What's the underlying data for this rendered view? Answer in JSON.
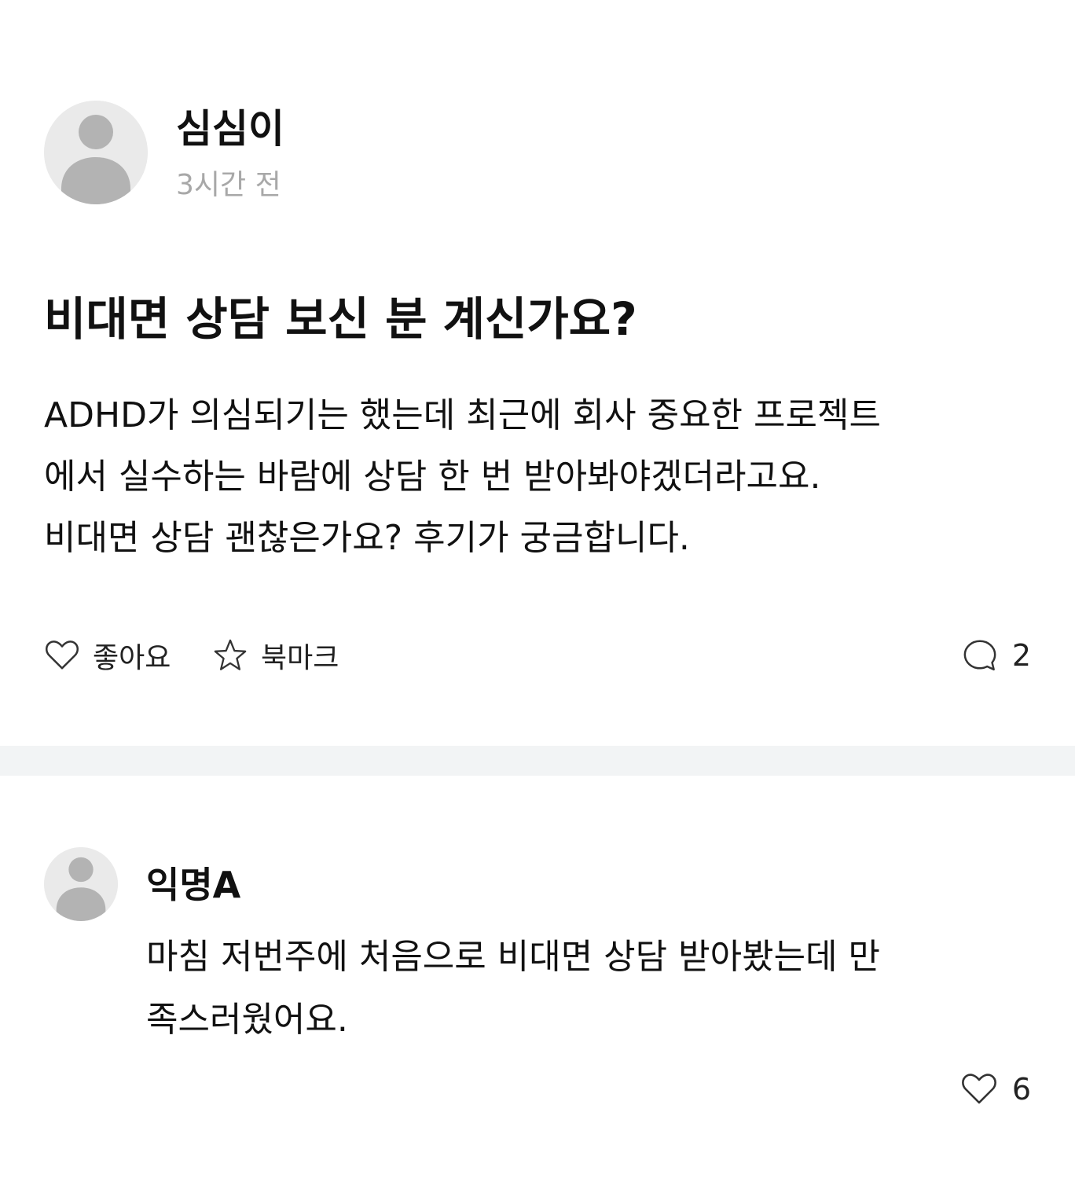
{
  "post": {
    "author": "심심이",
    "time": "3시간 전",
    "title": "비대면 상담 보신 분 계신가요?",
    "body_lines": [
      "ADHD가 의심되기는 했는데 최근에 회사 중요한 프로젝트",
      "에서 실수하는 바람에 상담 한 번 받아봐야겠더라고요.",
      "비대면 상담 괜찮은가요? 후기가 궁금합니다."
    ],
    "actions": {
      "like_label": "좋아요",
      "bookmark_label": "북마크",
      "comment_count": "2"
    },
    "icons": {
      "avatar": "user-avatar-icon",
      "like": "heart-icon",
      "bookmark": "star-icon",
      "comments": "speech-bubble-icon"
    }
  },
  "comments": [
    {
      "author": "익명A",
      "body_lines": [
        "마침 저번주에 처음으로 비대면 상담 받아봤는데 만",
        "족스러웠어요."
      ],
      "like_count": "6"
    }
  ],
  "colors": {
    "text": "#111111",
    "muted": "#a8a8a8",
    "avatar_bg": "#eaeaea",
    "avatar_fg": "#b3b3b3",
    "divider": "#f2f4f5"
  }
}
